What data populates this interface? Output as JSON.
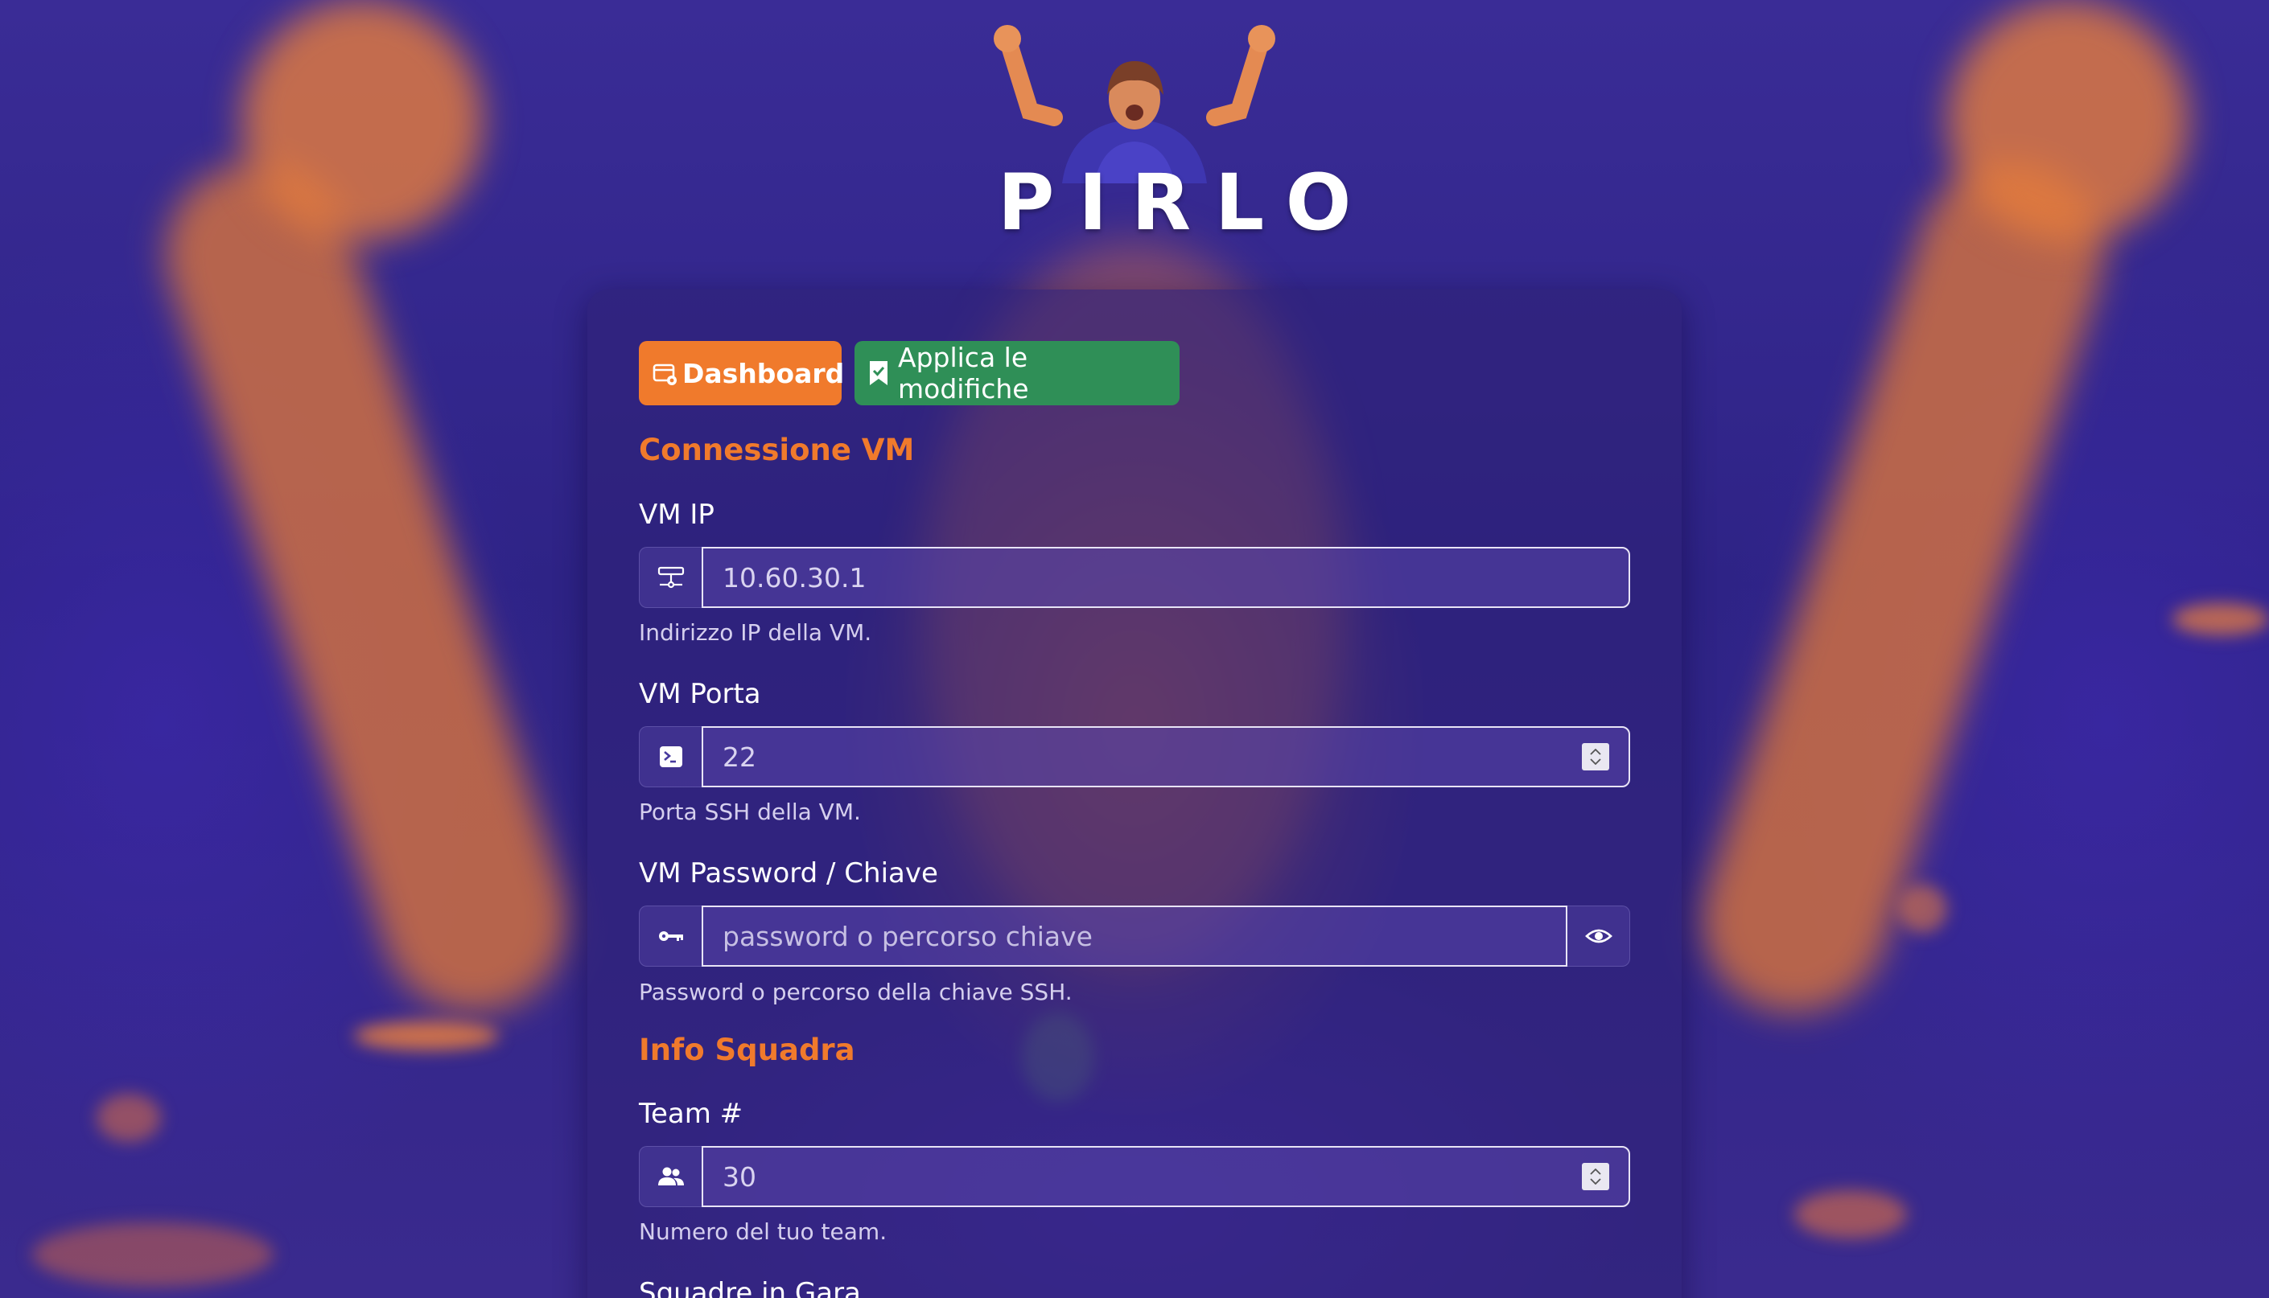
{
  "brand": {
    "logo_text": "PIRLO"
  },
  "toolbar": {
    "dashboard_label": "Dashboard",
    "apply_label": "Applica le modifiche"
  },
  "sections": {
    "vm_connection_title": "Connessione VM",
    "team_info_title": "Info Squadra"
  },
  "fields": {
    "vm_ip": {
      "label": "VM IP",
      "value": "10.60.30.1",
      "help": "Indirizzo IP della VM.",
      "icon": "server-icon"
    },
    "vm_port": {
      "label": "VM Porta",
      "value": "22",
      "help": "Porta SSH della VM.",
      "icon": "terminal-icon"
    },
    "vm_password": {
      "label": "VM Password / Chiave",
      "value": "",
      "placeholder": "password o percorso chiave",
      "help": "Password o percorso della chiave SSH.",
      "icon": "key-icon",
      "toggle_icon": "eye-icon"
    },
    "team_number": {
      "label": "Team #",
      "value": "30",
      "help": "Numero del tuo team.",
      "icon": "people-icon"
    },
    "teams_in_race": {
      "label": "Squadre in Gara"
    }
  },
  "colors": {
    "accent_orange": "#f07a2c",
    "apply_green": "#2f8f57",
    "background_purple": "#2e2386"
  }
}
